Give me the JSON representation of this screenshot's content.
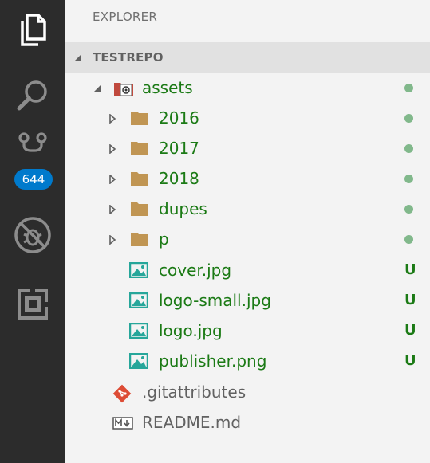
{
  "activity_bar": {
    "items": [
      {
        "icon": "files-icon"
      },
      {
        "icon": "search-icon"
      },
      {
        "icon": "source-control-icon",
        "badge": "644"
      },
      {
        "icon": "debug-disabled-icon"
      },
      {
        "icon": "extensions-icon"
      }
    ]
  },
  "explorer": {
    "title": "EXPLORER",
    "section": "TESTREPO",
    "tree": [
      {
        "label": "assets",
        "status": "•"
      },
      {
        "label": "2016",
        "status": "•"
      },
      {
        "label": "2017",
        "status": "•"
      },
      {
        "label": "2018",
        "status": "•"
      },
      {
        "label": "dupes",
        "status": "•"
      },
      {
        "label": "p",
        "status": "•"
      },
      {
        "label": "cover.jpg",
        "status": "U"
      },
      {
        "label": "logo-small.jpg",
        "status": "U"
      },
      {
        "label": "logo.jpg",
        "status": "U"
      },
      {
        "label": "publisher.png",
        "status": "U"
      },
      {
        "label": ".gitattributes"
      },
      {
        "label": "README.md"
      }
    ]
  },
  "colors": {
    "activity_bar_bg": "#2c2c2c",
    "sidebar_bg": "#f3f3f3",
    "section_header_bg": "#e1e1e1",
    "git_added_text": "#1b7a15",
    "git_dot": "#81b88b",
    "badge_bg": "#007acc",
    "folder": "#c09553",
    "image_icon": "#26a69a"
  }
}
